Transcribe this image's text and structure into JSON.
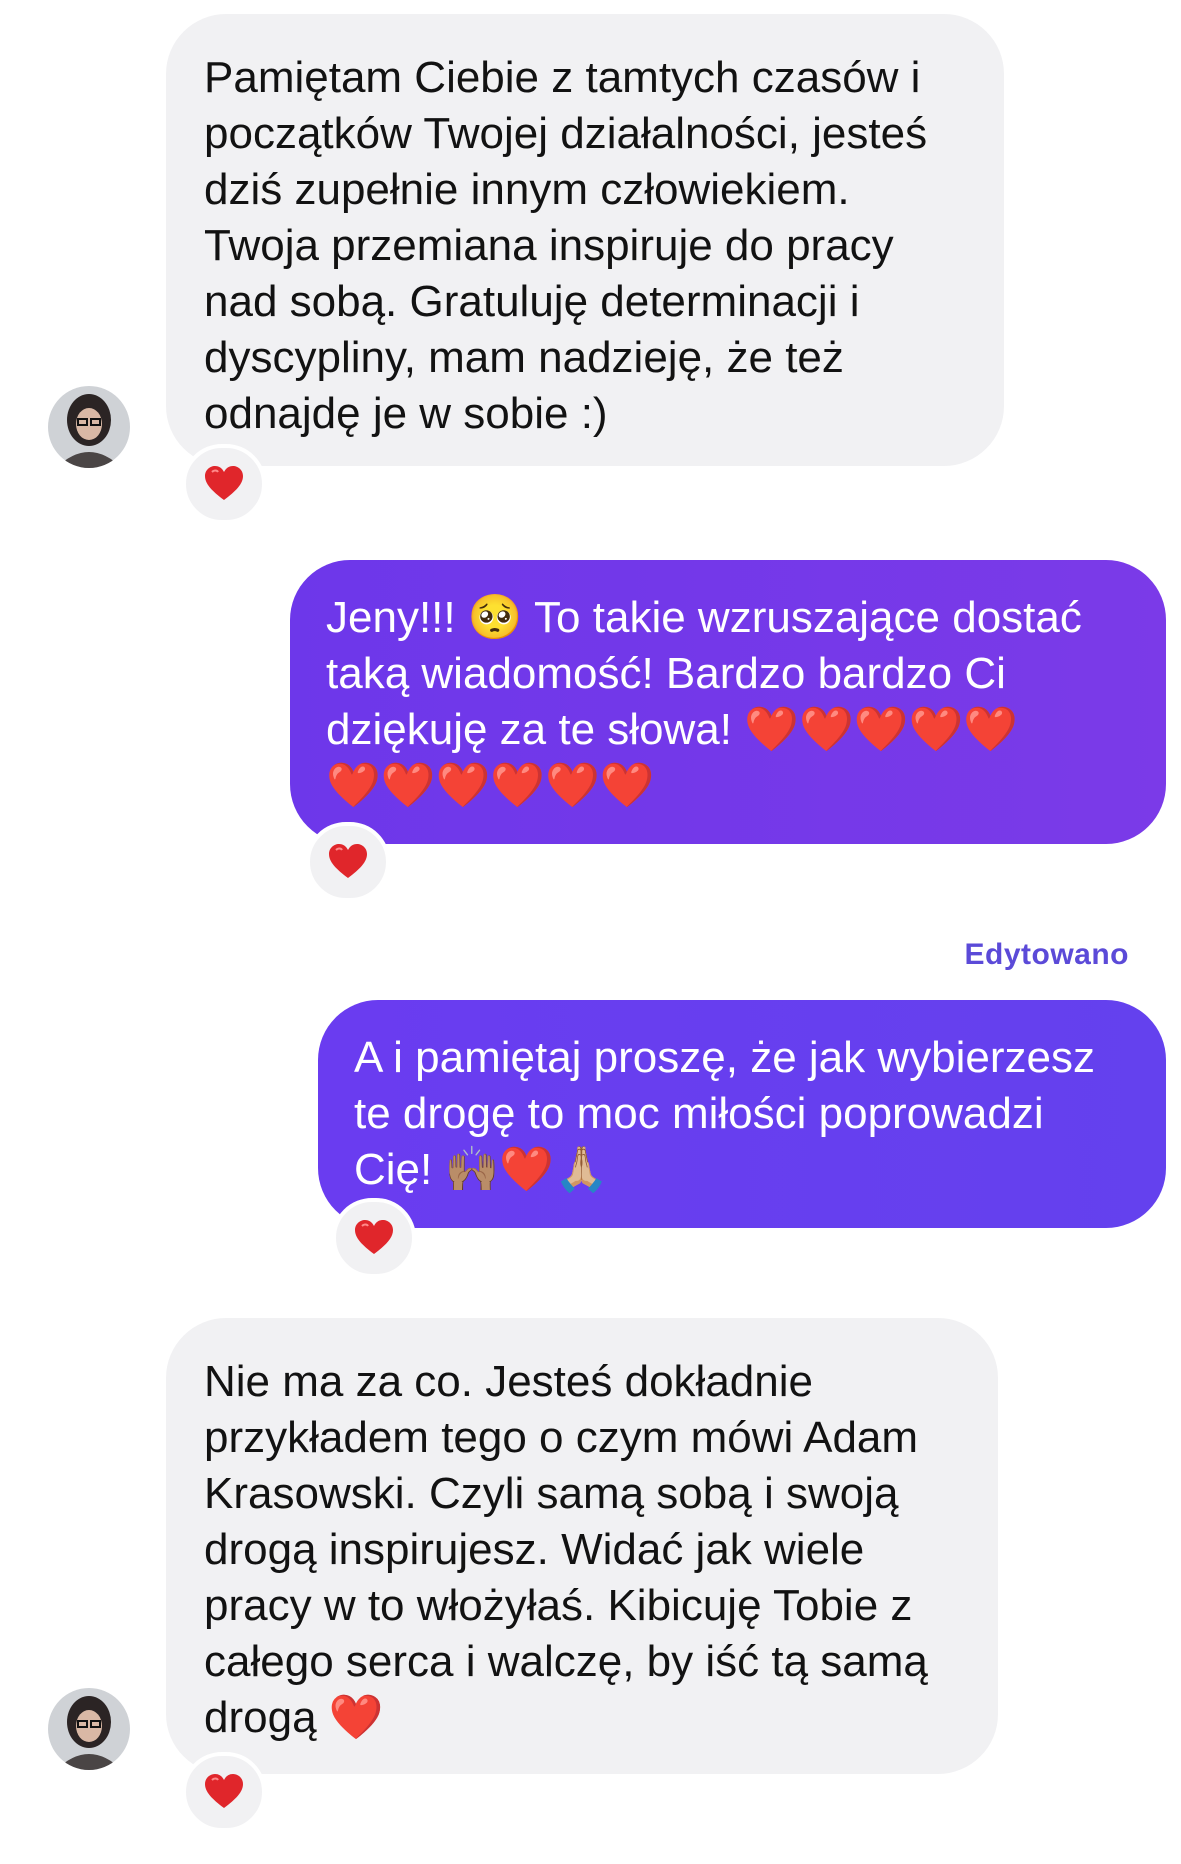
{
  "thread": {
    "messages": [
      {
        "direction": "incoming",
        "text": "Pamiętam Ciebie z tamtych czasów i\npoczątków Twojej działalności, jesteś\ndziś zupełnie innym człowiekiem.\nTwoja przemiana inspiruje do pracy\nnad sobą. Gratuluję determinacji i\ndyscypliny, mam nadzieję, że też\nodnajdę je w sobie :)",
        "reaction_icon": "red-heart-icon"
      },
      {
        "direction": "outgoing",
        "text": "Jeny!!! 🥺 To takie wzruszające dostać\ntaką wiadomość! Bardzo bardzo Ci\ndziękuję za te słowa! ❤️❤️❤️❤️❤️\n❤️❤️❤️❤️❤️❤️",
        "reaction_icon": "red-heart-icon"
      },
      {
        "direction": "outgoing",
        "edited_label": "Edytowano",
        "text": "A i pamiętaj proszę, że jak wybierzesz\nte drogę to moc miłości poprowadzi\nCię! 🙌🏽❤️🙏🏼",
        "reaction_icon": "red-heart-icon"
      },
      {
        "direction": "incoming",
        "text": "Nie ma za co. Jesteś dokładnie\nprzykładem tego o czym mówi Adam\nKrasowski. Czyli samą sobą i swoją\ndrogą inspirujesz. Widać jak wiele\npracy w to włożyłaś. Kibicuję Tobie z\ncałego serca i walczę, by iść tą samą\ndrogą ❤️",
        "reaction_icon": "red-heart-icon"
      }
    ]
  },
  "colors": {
    "incoming_bubble": "#f1f1f3",
    "outgoing_bubble": "#6d3aea",
    "edited_label": "#5b4ad8",
    "heart": "#e0262b"
  }
}
